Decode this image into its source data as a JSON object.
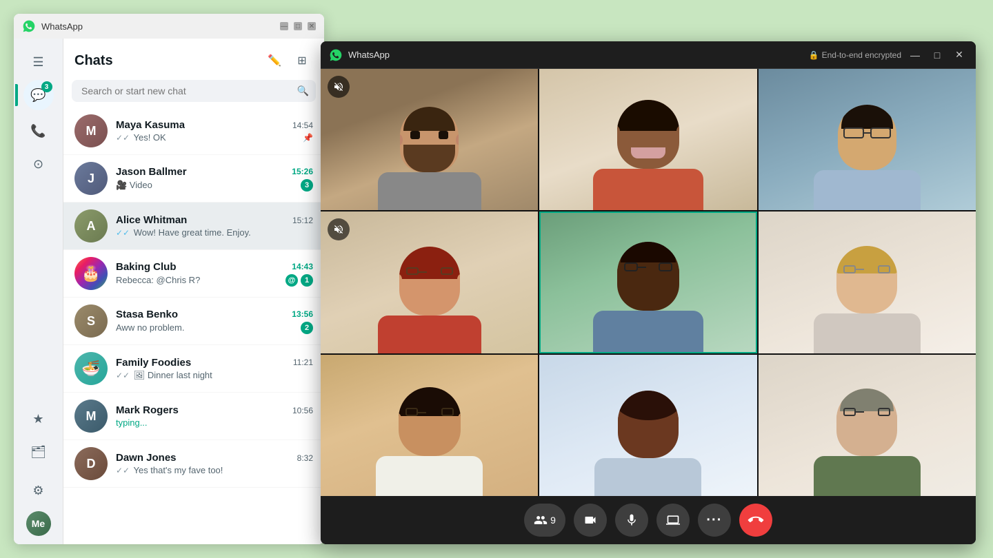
{
  "app": {
    "title": "WhatsApp",
    "titleBarControls": {
      "minimize": "—",
      "maximize": "□",
      "close": "✕"
    }
  },
  "sidebar": {
    "chatsBadge": "3",
    "items": [
      {
        "id": "menu",
        "icon": "☰",
        "label": "Menu",
        "active": false
      },
      {
        "id": "chats",
        "icon": "💬",
        "label": "Chats",
        "active": true,
        "badge": "3"
      },
      {
        "id": "calls",
        "icon": "📞",
        "label": "Calls",
        "active": false
      },
      {
        "id": "status",
        "icon": "○",
        "label": "Status",
        "active": false
      },
      {
        "id": "starred",
        "icon": "★",
        "label": "Starred",
        "active": false
      },
      {
        "id": "archived",
        "icon": "🗂",
        "label": "Archived",
        "active": false
      },
      {
        "id": "settings",
        "icon": "⚙",
        "label": "Settings",
        "active": false
      },
      {
        "id": "profile",
        "icon": "👤",
        "label": "Profile",
        "active": false
      }
    ]
  },
  "chatsPanel": {
    "title": "Chats",
    "newChatIcon": "✏",
    "filterIcon": "⊞",
    "search": {
      "placeholder": "Search or start new chat",
      "icon": "🔍"
    },
    "chats": [
      {
        "id": "maya",
        "name": "Maya Kasuma",
        "preview": "Yes! OK",
        "time": "14:54",
        "timeUnread": false,
        "unreadCount": 0,
        "pinned": true,
        "ticks": "double",
        "ticksRead": false,
        "avatarClass": "av-maya",
        "avatarText": "M",
        "active": false
      },
      {
        "id": "jason",
        "name": "Jason Ballmer",
        "preview": "🎥 Video",
        "time": "15:26",
        "timeUnread": true,
        "unreadCount": 3,
        "pinned": false,
        "ticks": "none",
        "ticksRead": false,
        "avatarClass": "av-jason",
        "avatarText": "J",
        "active": false
      },
      {
        "id": "alice",
        "name": "Alice Whitman",
        "preview": "Wow! Have great time. Enjoy.",
        "time": "15:12",
        "timeUnread": false,
        "unreadCount": 0,
        "pinned": false,
        "ticks": "double",
        "ticksRead": true,
        "avatarClass": "av-alice",
        "avatarText": "A",
        "active": true
      },
      {
        "id": "baking",
        "name": "Baking Club",
        "preview": "Rebecca: @Chris R?",
        "time": "14:43",
        "timeUnread": true,
        "unreadCount": 1,
        "mention": true,
        "pinned": false,
        "ticks": "none",
        "avatarClass": "av-baking",
        "avatarText": "🍰",
        "active": false
      },
      {
        "id": "stasa",
        "name": "Stasa Benko",
        "preview": "Aww no problem.",
        "time": "13:56",
        "timeUnread": true,
        "unreadCount": 2,
        "pinned": false,
        "ticks": "none",
        "avatarClass": "av-stasa",
        "avatarText": "S",
        "active": false
      },
      {
        "id": "family",
        "name": "Family Foodies",
        "preview": "Dinner last night",
        "time": "11:21",
        "timeUnread": false,
        "unreadCount": 0,
        "pinned": false,
        "ticks": "double",
        "ticksRead": false,
        "avatarClass": "av-family",
        "avatarText": "🍜",
        "active": false
      },
      {
        "id": "mark",
        "name": "Mark Rogers",
        "preview": "typing...",
        "time": "10:56",
        "timeUnread": false,
        "unreadCount": 0,
        "typing": true,
        "pinned": false,
        "ticks": "none",
        "avatarClass": "av-mark",
        "avatarText": "M",
        "active": false
      },
      {
        "id": "dawn",
        "name": "Dawn Jones",
        "preview": "Yes that's my fave too!",
        "time": "8:32",
        "timeUnread": false,
        "unreadCount": 0,
        "pinned": false,
        "ticks": "double",
        "ticksRead": false,
        "avatarClass": "av-dawn",
        "avatarText": "D",
        "active": false
      }
    ]
  },
  "callWindow": {
    "title": "WhatsApp",
    "encryption": "End-to-end encrypted",
    "titleBarControls": {
      "minimize": "—",
      "maximize": "□",
      "close": "✕"
    },
    "participants": [
      {
        "id": "p1",
        "muted": true,
        "speaking": false,
        "bg": "bg-kitchen"
      },
      {
        "id": "p2",
        "muted": false,
        "speaking": false,
        "bg": "bg-bright"
      },
      {
        "id": "p3",
        "muted": false,
        "speaking": false,
        "bg": "bg-office"
      },
      {
        "id": "p4",
        "muted": true,
        "speaking": false,
        "bg": "bg-home1"
      },
      {
        "id": "p5",
        "muted": false,
        "speaking": true,
        "bg": "bg-home2"
      },
      {
        "id": "p6",
        "muted": false,
        "speaking": false,
        "bg": "bg-bright2"
      },
      {
        "id": "p7",
        "muted": false,
        "speaking": false,
        "bg": "bg-home3"
      },
      {
        "id": "p8",
        "muted": false,
        "speaking": false,
        "bg": "bg-window"
      },
      {
        "id": "p9",
        "muted": false,
        "speaking": false,
        "bg": "bg-office2"
      }
    ],
    "bottomBar": {
      "participantCount": "9",
      "buttons": [
        {
          "id": "participants",
          "icon": "👥",
          "label": "Participants"
        },
        {
          "id": "video",
          "icon": "📹",
          "label": "Video"
        },
        {
          "id": "mute",
          "icon": "🎤",
          "label": "Mute"
        },
        {
          "id": "screen",
          "icon": "🖥",
          "label": "Screen share"
        },
        {
          "id": "more",
          "icon": "•••",
          "label": "More"
        },
        {
          "id": "endcall",
          "icon": "📞",
          "label": "End call"
        }
      ]
    }
  }
}
